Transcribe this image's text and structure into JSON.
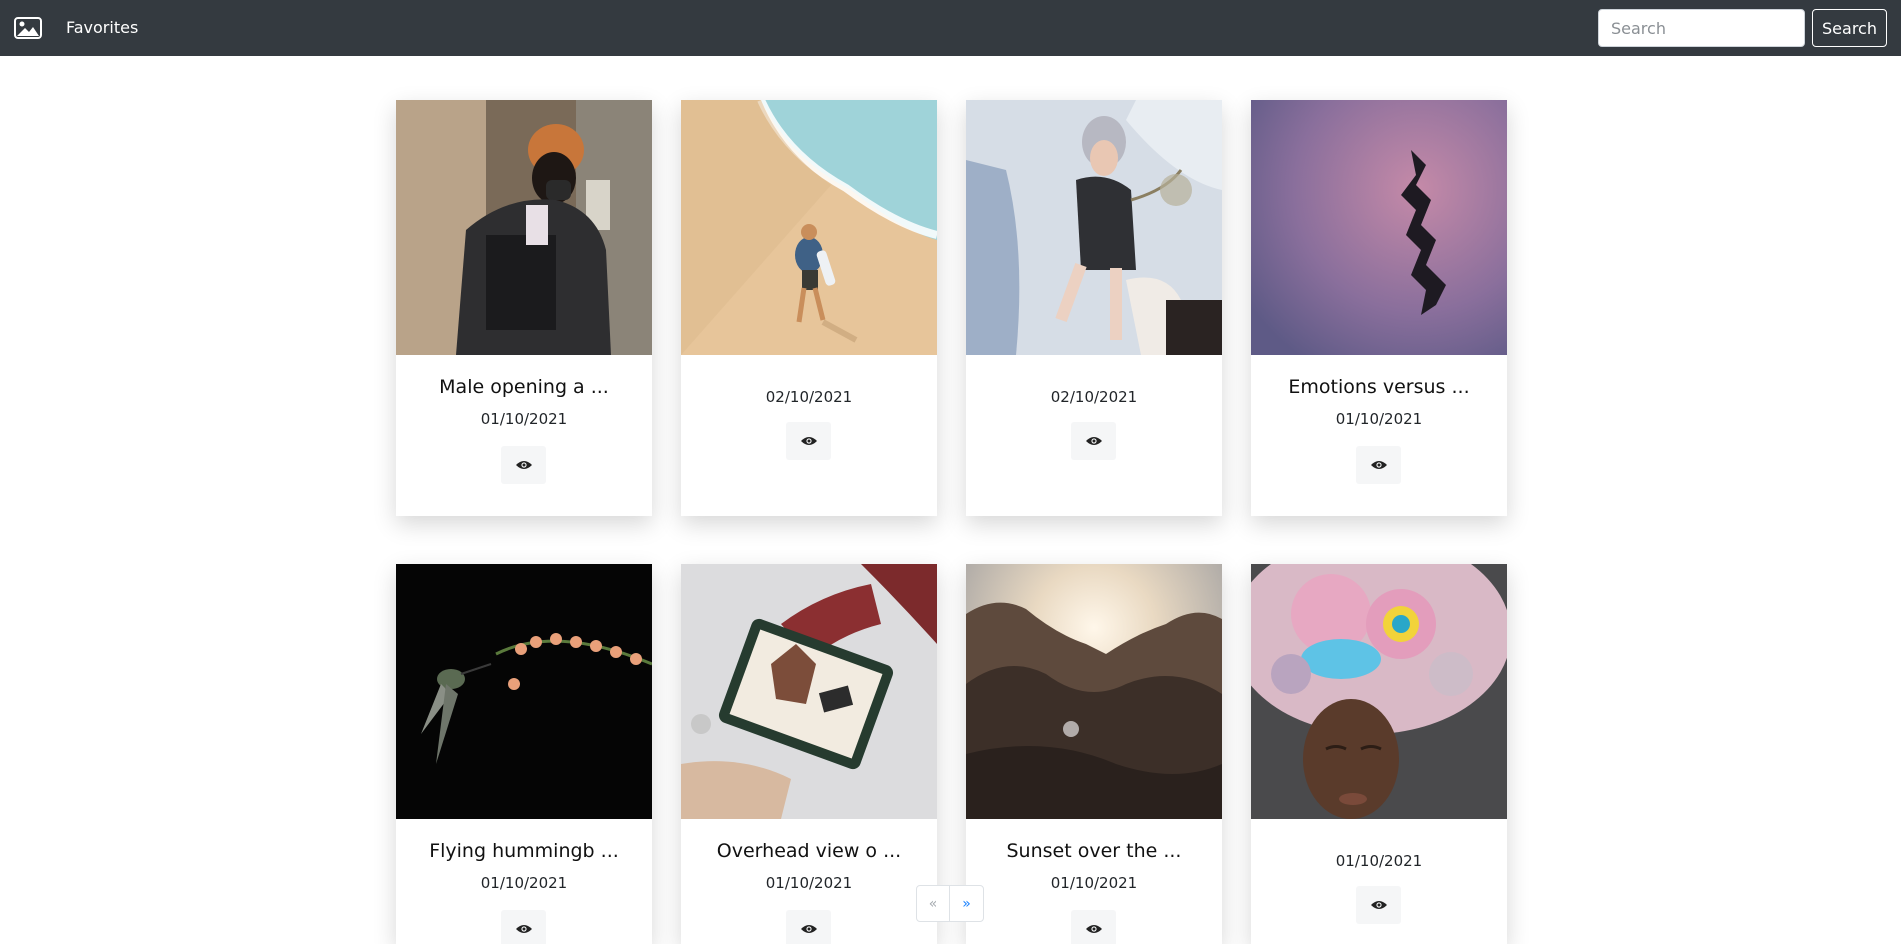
{
  "navbar": {
    "brand_icon": "image-icon",
    "favorites_label": "Favorites",
    "search_placeholder": "Search",
    "search_button": "Search",
    "background": "#343a40"
  },
  "cards": [
    {
      "title": "Male opening a ...",
      "date": "01/10/2021",
      "view_icon": "eye-icon"
    },
    {
      "title": "",
      "date": "02/10/2021",
      "view_icon": "eye-icon"
    },
    {
      "title": "",
      "date": "02/10/2021",
      "view_icon": "eye-icon"
    },
    {
      "title": "Emotions versus ...",
      "date": "01/10/2021",
      "view_icon": "eye-icon"
    },
    {
      "title": "Flying hummingb ...",
      "date": "01/10/2021",
      "view_icon": "eye-icon"
    },
    {
      "title": "Overhead view o ...",
      "date": "01/10/2021",
      "view_icon": "eye-icon"
    },
    {
      "title": "Sunset over the ...",
      "date": "01/10/2021",
      "view_icon": "eye-icon"
    },
    {
      "title": "",
      "date": "01/10/2021",
      "view_icon": "eye-icon"
    }
  ],
  "pagination": {
    "prev": "«",
    "next": "»"
  }
}
